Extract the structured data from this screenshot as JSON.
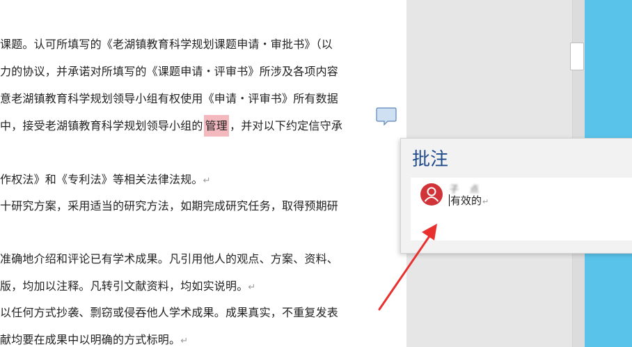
{
  "document": {
    "lines": [
      {
        "text": "课题。认可所填写的《老湖镇教育科学规划课题申请・审批书》（以",
        "para_mark": false
      },
      {
        "text": "力的协议，并承诺对所填写的《课题申请・评审书》所涉及各项内容",
        "para_mark": false
      },
      {
        "text": "意老湖镇教育科学规划领导小组有权使用《申请・评审书》所有数据",
        "para_mark": false
      },
      {
        "before": "中，接受老湖镇教育科学规划领导小组的",
        "highlight": "管理",
        "after": "，并对以下约定信守承"
      },
      {
        "text": "作权法》和《专利法》等相关法律法规。",
        "para_mark": true
      },
      {
        "text": "十研究方案，采用适当的研究方法，如期完成研究任务，取得预期研",
        "para_mark": false
      },
      {
        "text": " 准确地介绍和评论已有学术成果。凡引用他人的观点、方案、资料、",
        "para_mark": false
      },
      {
        "text": "版，均加以注释。凡转引文献资料，均如实说明。",
        "para_mark": true
      },
      {
        "text": "以任何方式抄袭、剽窃或侵吞他人学术成果。成果真实，不重复发表",
        "para_mark": false
      },
      {
        "text": "献均要在成果中以明确的方式标明。",
        "para_mark": true
      }
    ],
    "para_mark_glyph": "↵"
  },
  "comments_pane": {
    "title": "批注",
    "comment": {
      "author": "子 点",
      "text": "有效的",
      "end_mark": "↵"
    }
  },
  "colors": {
    "highlight": "#f3b9bf",
    "panel_title": "#1f4a8a",
    "avatar": "#d13438",
    "arrow": "#e8312f",
    "taskbar": "#5ac3e9"
  }
}
